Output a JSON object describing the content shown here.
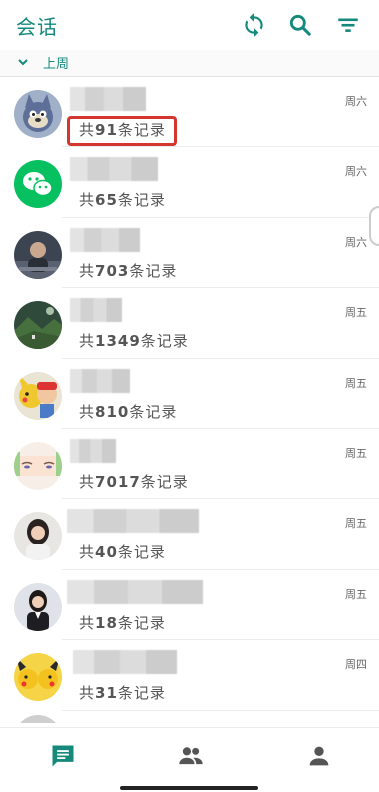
{
  "header": {
    "title": "会话",
    "icons": [
      "sync-icon",
      "search-icon",
      "filter-icon"
    ],
    "accent_color": "#14897c"
  },
  "section": {
    "label": "上周"
  },
  "conversations": [
    {
      "count_prefix": "共",
      "count": "91",
      "count_suffix": "条记录",
      "day": "周六",
      "avatar": "cartoon-cat-avatar"
    },
    {
      "count_prefix": "共",
      "count": "65",
      "count_suffix": "条记录",
      "day": "周六",
      "avatar": "wechat-avatar"
    },
    {
      "count_prefix": "共",
      "count": "703",
      "count_suffix": "条记录",
      "day": "周六",
      "avatar": "person-photo-avatar"
    },
    {
      "count_prefix": "共",
      "count": "1349",
      "count_suffix": "条记录",
      "day": "周五",
      "avatar": "landscape-avatar"
    },
    {
      "count_prefix": "共",
      "count": "810",
      "count_suffix": "条记录",
      "day": "周五",
      "avatar": "cartoon-pikachu-avatar"
    },
    {
      "count_prefix": "共",
      "count": "7017",
      "count_suffix": "条记录",
      "day": "周五",
      "avatar": "anime-face-avatar"
    },
    {
      "count_prefix": "共",
      "count": "40",
      "count_suffix": "条记录",
      "day": "周五",
      "avatar": "woman-photo-avatar"
    },
    {
      "count_prefix": "共",
      "count": "18",
      "count_suffix": "条记录",
      "day": "周五",
      "avatar": "woman-suit-avatar"
    },
    {
      "count_prefix": "共",
      "count": "31",
      "count_suffix": "条记录",
      "day": "周四",
      "avatar": "pikachu-group-avatar"
    }
  ],
  "bottom_nav": {
    "items": [
      "chat-icon",
      "contacts-icon",
      "profile-icon"
    ],
    "active_color": "#14897c",
    "inactive_color": "#555555"
  },
  "highlight_color": "#d4352f"
}
